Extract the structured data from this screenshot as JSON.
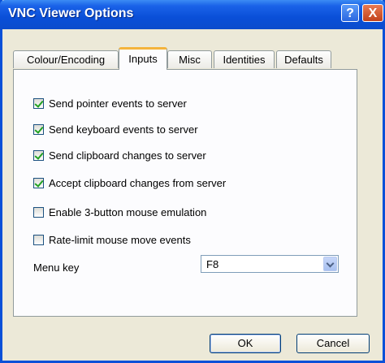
{
  "window": {
    "title": "VNC Viewer Options",
    "help_glyph": "?",
    "close_glyph": "X"
  },
  "tabs": [
    {
      "label": "Colour/Encoding",
      "active": false
    },
    {
      "label": "Inputs",
      "active": true
    },
    {
      "label": "Misc",
      "active": false
    },
    {
      "label": "Identities",
      "active": false
    },
    {
      "label": "Defaults",
      "active": false
    }
  ],
  "options": [
    {
      "label": "Send pointer events to server",
      "checked": true
    },
    {
      "label": "Send keyboard events to server",
      "checked": true
    },
    {
      "label": "Send clipboard changes to server",
      "checked": true
    },
    {
      "label": "Accept clipboard changes from server",
      "checked": true
    },
    {
      "label": "Enable 3-button mouse emulation",
      "checked": false
    },
    {
      "label": "Rate-limit mouse move events",
      "checked": false
    }
  ],
  "menu_key": {
    "label": "Menu key",
    "value": "F8"
  },
  "buttons": {
    "ok": "OK",
    "cancel": "Cancel"
  }
}
